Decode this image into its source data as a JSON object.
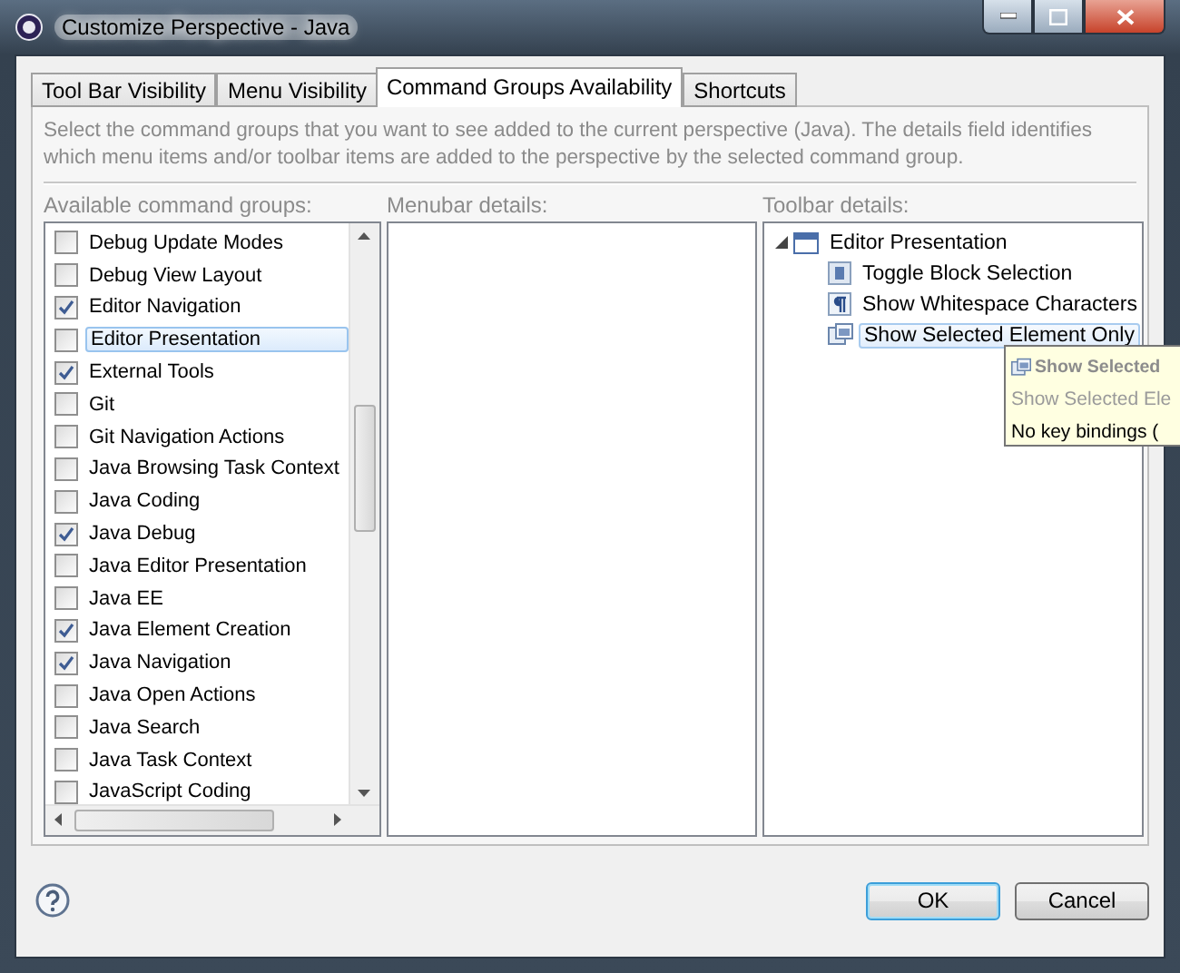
{
  "window": {
    "title": "Customize Perspective - Java"
  },
  "tabs": [
    {
      "label": "Tool Bar Visibility",
      "selected": false
    },
    {
      "label": "Menu Visibility",
      "selected": false
    },
    {
      "label": "Command Groups Availability",
      "selected": true
    },
    {
      "label": "Shortcuts",
      "selected": false
    }
  ],
  "description": "Select the command groups that you want to see added to the current perspective (Java).  The details field identifies which menu items and/or toolbar items are added to the perspective by the selected command group.",
  "command_groups": {
    "label": "Available command groups:",
    "items": [
      {
        "label": "Debug Update Modes",
        "checked": false,
        "selected": false
      },
      {
        "label": "Debug View Layout",
        "checked": false,
        "selected": false
      },
      {
        "label": "Editor Navigation",
        "checked": true,
        "selected": false
      },
      {
        "label": "Editor Presentation",
        "checked": false,
        "selected": true
      },
      {
        "label": "External Tools",
        "checked": true,
        "selected": false
      },
      {
        "label": "Git",
        "checked": false,
        "selected": false
      },
      {
        "label": "Git Navigation Actions",
        "checked": false,
        "selected": false
      },
      {
        "label": "Java Browsing Task Context",
        "checked": false,
        "selected": false
      },
      {
        "label": "Java Coding",
        "checked": false,
        "selected": false
      },
      {
        "label": "Java Debug",
        "checked": true,
        "selected": false
      },
      {
        "label": "Java Editor Presentation",
        "checked": false,
        "selected": false
      },
      {
        "label": "Java EE",
        "checked": false,
        "selected": false
      },
      {
        "label": "Java Element Creation",
        "checked": true,
        "selected": false
      },
      {
        "label": "Java Navigation",
        "checked": true,
        "selected": false
      },
      {
        "label": "Java Open Actions",
        "checked": false,
        "selected": false
      },
      {
        "label": "Java Search",
        "checked": false,
        "selected": false
      },
      {
        "label": "Java Task Context",
        "checked": false,
        "selected": false
      },
      {
        "label": "JavaScript Coding",
        "checked": false,
        "selected": false
      }
    ]
  },
  "menubar_details": {
    "label": "Menubar details:"
  },
  "toolbar_details": {
    "label": "Toolbar details:",
    "tree": [
      {
        "label": "Editor Presentation",
        "expanded": true,
        "selected": false,
        "children": [
          {
            "label": "Toggle Block Selection",
            "kind": "block",
            "selected": false
          },
          {
            "label": "Show Whitespace Characters",
            "kind": "pilcrow",
            "selected": false
          },
          {
            "label": "Show Selected Element Only",
            "kind": "element",
            "selected": true
          }
        ]
      }
    ]
  },
  "tooltip": {
    "title": "Show Selected",
    "description": "Show Selected Ele",
    "key_bindings": "No key bindings ("
  },
  "buttons": [
    {
      "label": "OK",
      "default": true
    },
    {
      "label": "Cancel",
      "default": false
    }
  ]
}
